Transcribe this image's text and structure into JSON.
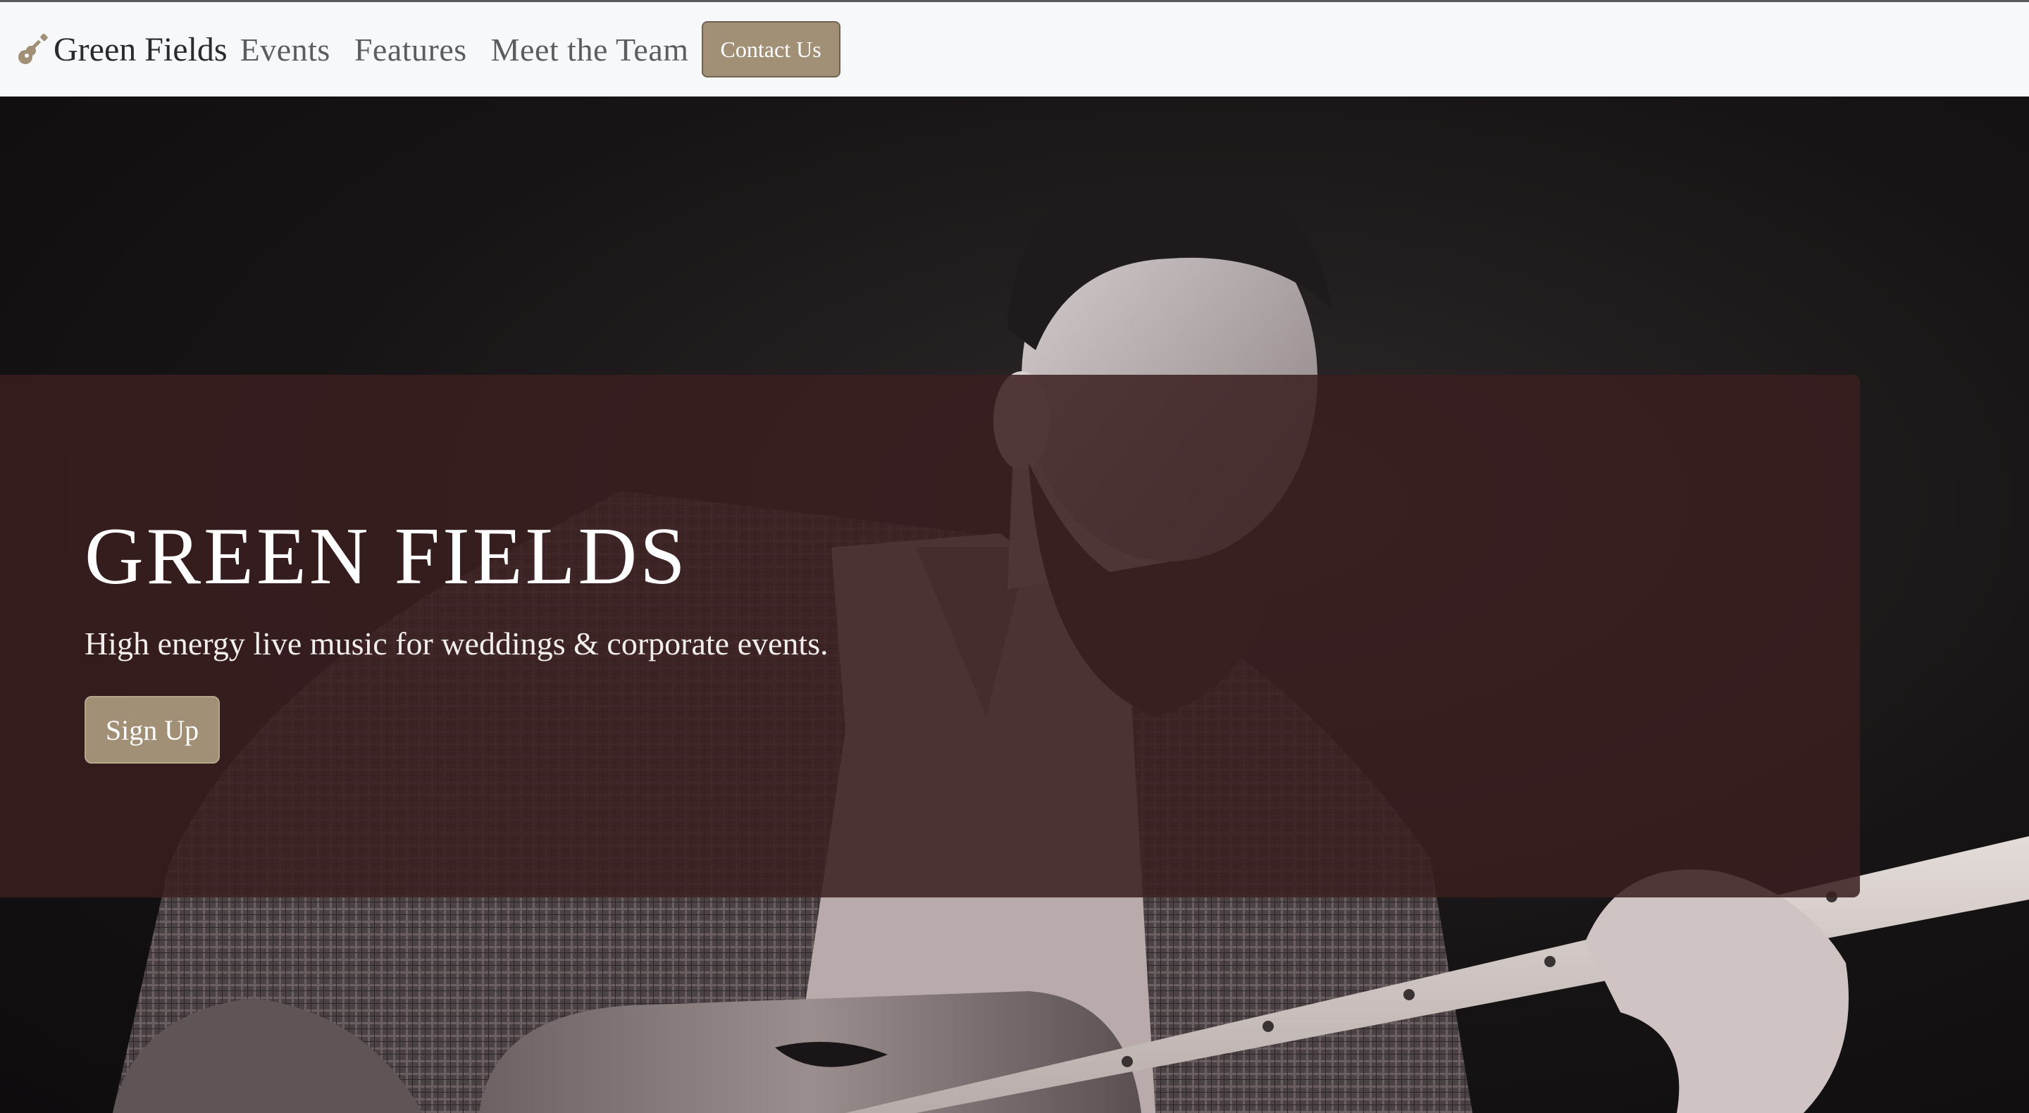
{
  "navbar": {
    "brand": "Green Fields",
    "brand_icon": "guitar-icon",
    "links": [
      {
        "label": "Events"
      },
      {
        "label": "Features"
      },
      {
        "label": "Meet the Team"
      }
    ],
    "contact_label": "Contact Us"
  },
  "hero": {
    "title": "GREEN FIELDS",
    "subtitle": "High energy live music for weddings & corporate events.",
    "cta_label": "Sign Up",
    "photo": "guitarist-photo"
  },
  "colors": {
    "navbar_bg": "#f7f8fa",
    "accent_button": "#a18f76",
    "overlay": "#3a1e1f",
    "hero_bg": "#171415"
  }
}
